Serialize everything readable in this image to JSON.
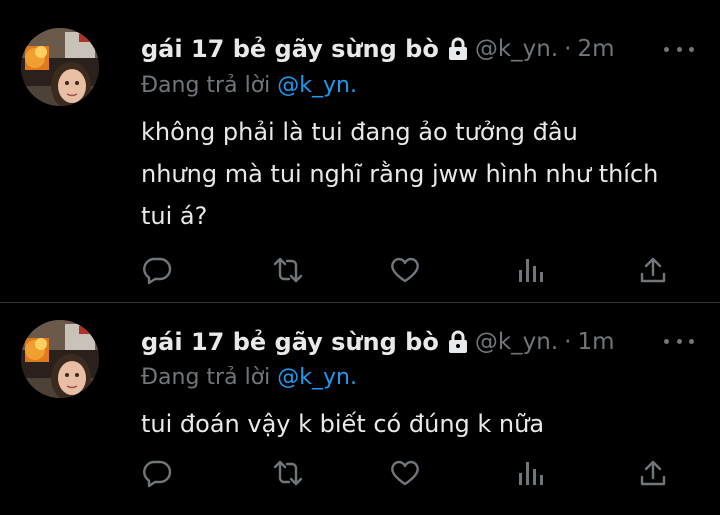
{
  "tweets": [
    {
      "display_name": "gái 17 bẻ gãy sừng bò",
      "handle": "@k_yn.",
      "separator": "·",
      "time": "2m",
      "reply_prefix": "Đang trả lời",
      "reply_to": "@k_yn.",
      "text": "không phải là tui đang ảo tưởng đâu nhưng mà tui nghĩ rằng jww hình như thích tui á?"
    },
    {
      "display_name": "gái 17 bẻ gãy sừng bò",
      "handle": "@k_yn.",
      "separator": "·",
      "time": "1m",
      "reply_prefix": "Đang trả lời",
      "reply_to": "@k_yn.",
      "text": "tui đoán vậy k biết có đúng k nữa"
    }
  ],
  "icons": {
    "lock": "lock-icon",
    "more": "more-icon",
    "reply": "reply-icon",
    "retweet": "retweet-icon",
    "like": "like-icon",
    "views": "views-icon",
    "share": "share-icon"
  },
  "colors": {
    "background": "#000000",
    "text": "#e7e9ea",
    "secondary": "#71767b",
    "accent": "#1d9bf0",
    "divider": "#2f3336"
  }
}
